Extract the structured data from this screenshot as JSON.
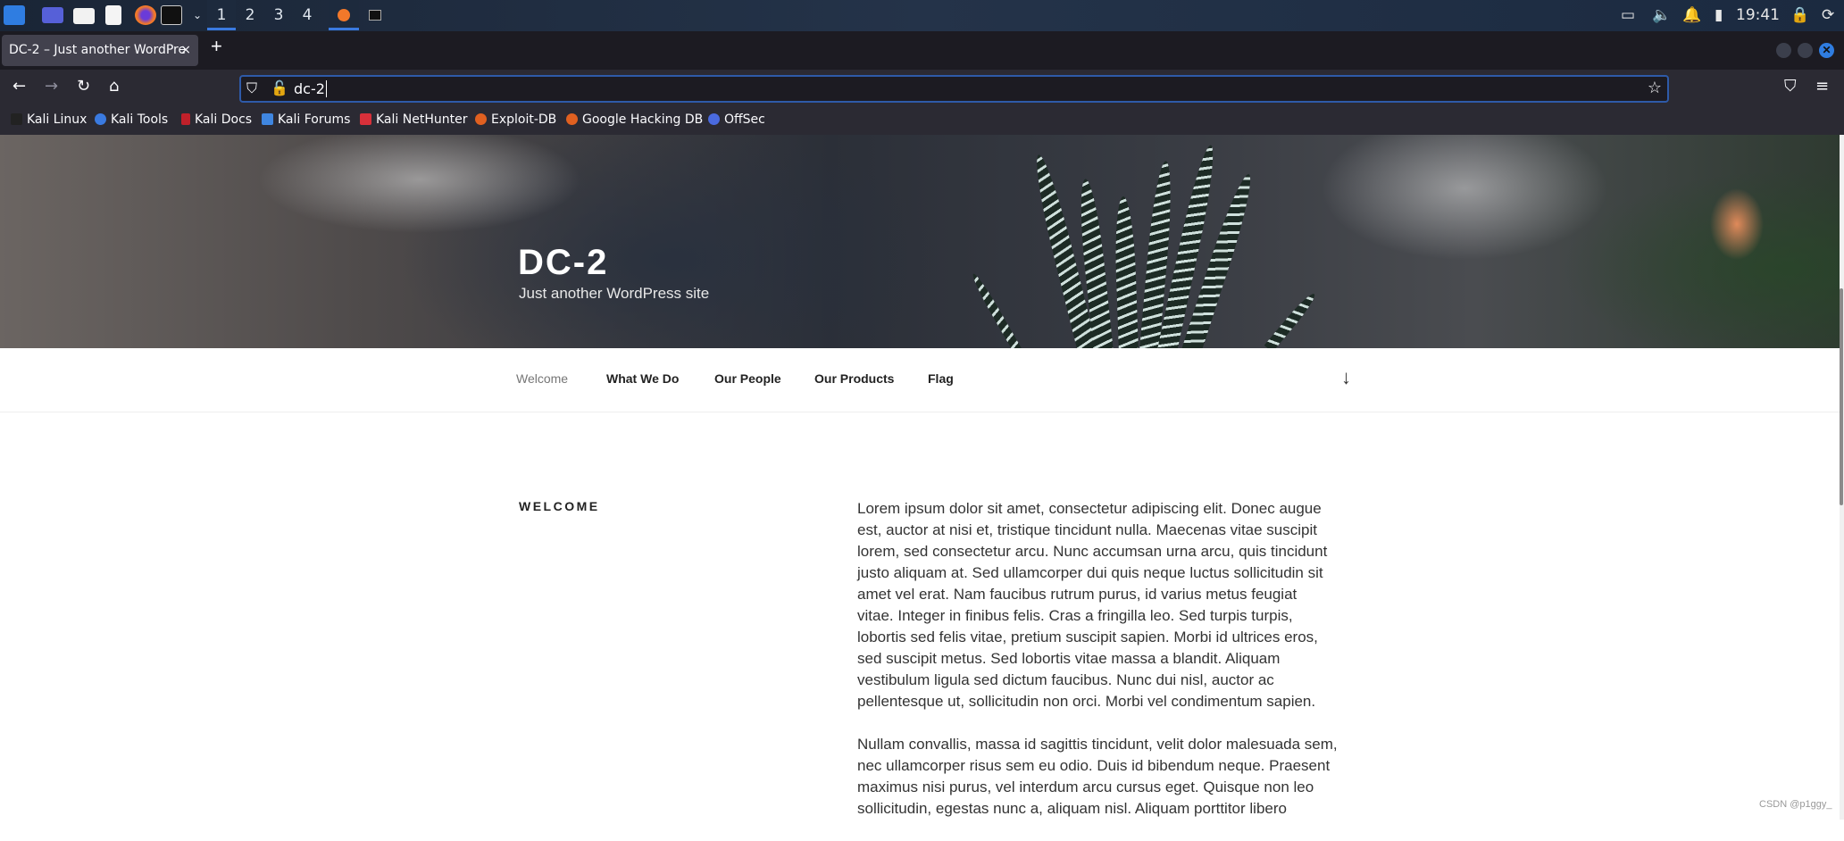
{
  "taskbar": {
    "workspaces": [
      "1",
      "2",
      "3",
      "4"
    ],
    "active_workspace": "1",
    "clock": "19:41",
    "icons": [
      "kali-menu-icon",
      "desktop-icon",
      "file-manager-icon",
      "text-editor-icon",
      "firefox-icon",
      "terminal-icon"
    ],
    "tray_icons": [
      "network-icon",
      "volume-icon",
      "notification-icon",
      "battery-icon",
      "lock-icon",
      "logout-icon"
    ]
  },
  "browser": {
    "tab_title": "DC-2 – Just another WordPre",
    "tab_close": "×",
    "new_tab": "+",
    "url": "dc-2",
    "bookmarks": [
      {
        "label": "Kali Linux",
        "color": "#222222"
      },
      {
        "label": "Kali Tools",
        "color": "#3a7ae0"
      },
      {
        "label": "Kali Docs",
        "color": "#c0202a"
      },
      {
        "label": "Kali Forums",
        "color": "#3f86e0"
      },
      {
        "label": "Kali NetHunter",
        "color": "#d8303a"
      },
      {
        "label": "Exploit-DB",
        "color": "#e06020"
      },
      {
        "label": "Google Hacking DB",
        "color": "#e06020"
      },
      {
        "label": "OffSec",
        "color": "#4a6adf"
      }
    ]
  },
  "site": {
    "title": "DC-2",
    "tagline": "Just another WordPress site",
    "menu": [
      "Welcome",
      "What We Do",
      "Our People",
      "Our Products",
      "Flag"
    ],
    "section_heading": "WELCOME",
    "paragraphs": [
      [
        "Lorem ipsum dolor sit amet, consectetur adipiscing elit. Donec augue",
        "est, auctor at nisi et, tristique tincidunt nulla. Maecenas vitae suscipit",
        "lorem, sed consectetur arcu. Nunc accumsan urna arcu, quis tincidunt",
        "justo aliquam at. Sed ullamcorper dui quis neque luctus sollicitudin sit",
        "amet vel erat. Nam faucibus rutrum purus, id varius metus feugiat",
        "vitae. Integer in finibus felis. Cras a fringilla leo. Sed turpis turpis,",
        "lobortis sed felis vitae, pretium suscipit sapien. Morbi id ultrices eros,",
        "sed suscipit metus. Sed lobortis vitae massa a blandit. Aliquam",
        "vestibulum ligula sed dictum faucibus. Nunc dui nisl, auctor ac",
        "pellentesque ut, sollicitudin non orci. Morbi vel condimentum sapien."
      ],
      [
        "Nullam convallis, massa id sagittis tincidunt, velit dolor malesuada sem,",
        "nec ullamcorper risus sem eu odio. Duis id bibendum neque. Praesent",
        "maximus nisi purus, vel interdum arcu cursus eget. Quisque non leo",
        "sollicitudin, egestas nunc a, aliquam nisl. Aliquam porttitor libero"
      ]
    ]
  },
  "watermark": "CSDN @p1ggy_"
}
